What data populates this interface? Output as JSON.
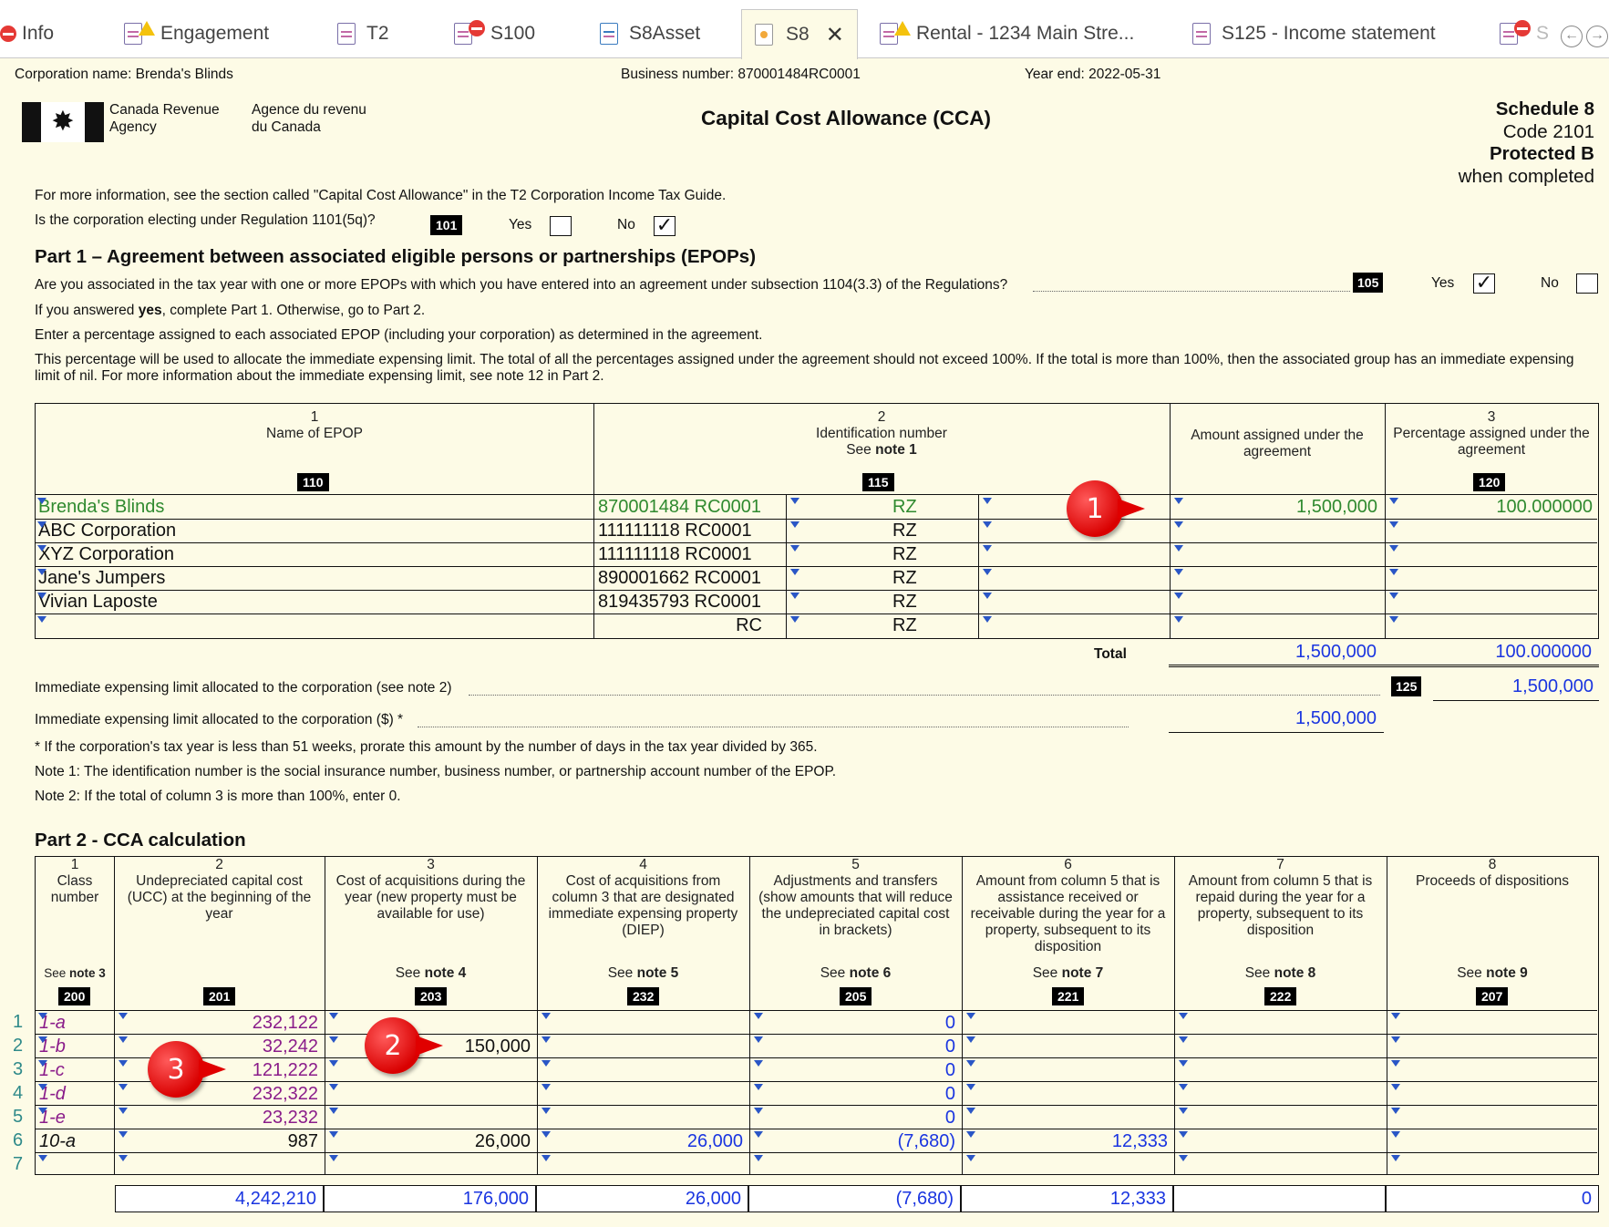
{
  "tabs": [
    {
      "label": "Info",
      "icon": "error-icon"
    },
    {
      "label": "Engagement",
      "icon": "warning-doc-icon"
    },
    {
      "label": "T2",
      "icon": "doc-icon"
    },
    {
      "label": "S100",
      "icon": "error-doc-icon"
    },
    {
      "label": "S8Asset",
      "icon": "doc-icon"
    },
    {
      "label": "S8",
      "icon": "active-doc-icon",
      "close": "✕"
    },
    {
      "label": "Rental - 1234 Main Stre...",
      "icon": "warning-doc-icon"
    },
    {
      "label": "S125 - Income statement",
      "icon": "doc-icon"
    },
    {
      "label": "S",
      "icon": "error-doc-icon"
    }
  ],
  "header": {
    "corp_name": "Corporation name: Brenda's Blinds",
    "business_number": "Business number: 870001484RC0001",
    "year_end": "Year end: 2022-05-31",
    "agency_en_1": "Canada Revenue",
    "agency_en_2": "Agency",
    "agency_fr_1": "Agence du revenu",
    "agency_fr_2": "du Canada",
    "title": "Capital Cost Allowance (CCA)",
    "schedule": "Schedule 8",
    "code": "Code 2101",
    "protected": "Protected B",
    "when_completed": "when completed"
  },
  "intro": {
    "more_info": "For more information, see the section called \"Capital Cost Allowance\" in the T2 Corporation Income Tax Guide.",
    "regulation_q": "Is the corporation electing under Regulation 1101(5q)?",
    "code": "101",
    "yes": "Yes",
    "no": "No",
    "checked_mark": "✓"
  },
  "part1": {
    "title": "Part 1 – Agreement between associated eligible persons or partnerships (EPOPs)",
    "question": "Are you associated in the tax year with one or more EPOPs with which you have entered into an agreement under subsection 1104(3.3) of the Regulations?",
    "code": "105",
    "yes": "Yes",
    "no": "No",
    "answer_pre": "If you answered ",
    "answer_bold": "yes",
    "answer_post": ", complete Part 1. Otherwise, go to Part 2.",
    "enter_pct": "Enter a percentage assigned to each associated EPOP (including your corporation) as determined in the agreement.",
    "pct_note": "This percentage will be used to allocate the immediate expensing limit. The total of all the percentages assigned under the agreement should not exceed 100%. If the total is more than 100%, then the associated group has an immediate expensing limit of nil. For more information about the immediate expensing limit, see note 12 in Part 2.",
    "col1_num": "1",
    "col1_label": "Name of EPOP",
    "col1_code": "110",
    "col2_num": "2",
    "col2_label": "Identification number",
    "col2_note_pre": "See ",
    "col2_note": "note 1",
    "col2_code": "115",
    "col_amount_label": "Amount assigned under the agreement",
    "col3_num": "3",
    "col3_label": "Percentage assigned under the agreement",
    "col3_code": "120",
    "rows": [
      {
        "name": "Brenda's Blinds",
        "id": "870001484 RC0001",
        "rz": "RZ",
        "amount": "1,500,000",
        "pct": "100.000000"
      },
      {
        "name": "ABC Corporation",
        "id": "111111118 RC0001",
        "rz": "RZ",
        "amount": "",
        "pct": ""
      },
      {
        "name": "XYZ Corporation",
        "id": "111111118 RC0001",
        "rz": "RZ",
        "amount": "",
        "pct": ""
      },
      {
        "name": "Jane's Jumpers",
        "id": "890001662 RC0001",
        "rz": "RZ",
        "amount": "",
        "pct": ""
      },
      {
        "name": "Vivian Laposte",
        "id": "819435793 RC0001",
        "rz": "RZ",
        "amount": "",
        "pct": ""
      },
      {
        "name": "",
        "id": "RC",
        "rz": "RZ",
        "amount": "",
        "pct": ""
      }
    ],
    "total_label": "Total",
    "total_amount": "1,500,000",
    "total_pct": "100.000000",
    "limit1_label": "Immediate expensing limit allocated to the corporation (see note 2)",
    "limit1_code": "125",
    "limit1_value": "1,500,000",
    "limit2_label": "Immediate expensing limit allocated to the corporation ($) *",
    "limit2_value": "1,500,000",
    "footnote": "* If the corporation's tax year is less than 51 weeks, prorate this amount by the number of days in the tax year divided by 365.",
    "note1": "Note 1: The identification number is the social insurance number, business number, or partnership account number of the EPOP.",
    "note2": "Note 2: If the total of column 3 is more than 100%, enter 0."
  },
  "part2": {
    "title": "Part 2 - CCA calculation",
    "columns": [
      {
        "num": "1",
        "label": "Class number",
        "note_pre": "See ",
        "note": "note 3",
        "code": "200"
      },
      {
        "num": "2",
        "label": "Undepreciated capital cost (UCC) at the beginning of the year",
        "note_pre": "",
        "note": "",
        "code": "201"
      },
      {
        "num": "3",
        "label": "Cost of acquisitions during the year (new property must be available for use)",
        "note_pre": "See ",
        "note": "note 4",
        "code": "203"
      },
      {
        "num": "4",
        "label": "Cost of acquisitions from column 3 that are designated immediate expensing property (DIEP)",
        "note_pre": "See ",
        "note": "note 5",
        "code": "232"
      },
      {
        "num": "5",
        "label": "Adjustments and transfers (show amounts that will reduce the undepreciated capital cost in brackets)",
        "note_pre": "See ",
        "note": "note 6",
        "code": "205"
      },
      {
        "num": "6",
        "label": "Amount from column 5 that is assistance received or receivable during the year for a property, subsequent to its disposition",
        "note_pre": "See ",
        "note": "note 7",
        "code": "221"
      },
      {
        "num": "7",
        "label": "Amount from column 5 that is repaid during the year for a property, subsequent to its disposition",
        "note_pre": "See ",
        "note": "note 8",
        "code": "222"
      },
      {
        "num": "8",
        "label": "Proceeds of dispositions",
        "note_pre": "See ",
        "note": "note 9",
        "code": "207"
      }
    ],
    "rows": [
      {
        "n": "1",
        "cls": "1-a",
        "ucc": "232,122",
        "acq": "",
        "diep": "",
        "adj": "0",
        "assist": "",
        "repaid": "",
        "proceeds": ""
      },
      {
        "n": "2",
        "cls": "1-b",
        "ucc": "32,242",
        "acq": "150,000",
        "diep": "",
        "adj": "0",
        "assist": "",
        "repaid": "",
        "proceeds": ""
      },
      {
        "n": "3",
        "cls": "1-c",
        "ucc": "121,222",
        "acq": "",
        "diep": "",
        "adj": "0",
        "assist": "",
        "repaid": "",
        "proceeds": ""
      },
      {
        "n": "4",
        "cls": "1-d",
        "ucc": "232,322",
        "acq": "",
        "diep": "",
        "adj": "0",
        "assist": "",
        "repaid": "",
        "proceeds": ""
      },
      {
        "n": "5",
        "cls": "1-e",
        "ucc": "23,232",
        "acq": "",
        "diep": "",
        "adj": "0",
        "assist": "",
        "repaid": "",
        "proceeds": ""
      },
      {
        "n": "6",
        "cls": "10-a",
        "ucc": "987",
        "acq": "26,000",
        "diep": "26,000",
        "adj": "(7,680)",
        "assist": "12,333",
        "repaid": "",
        "proceeds": ""
      },
      {
        "n": "7",
        "cls": "",
        "ucc": "",
        "acq": "",
        "diep": "",
        "adj": "",
        "assist": "",
        "repaid": "",
        "proceeds": ""
      }
    ],
    "totals": {
      "ucc": "4,242,210",
      "acq": "176,000",
      "diep": "26,000",
      "adj": "(7,680)",
      "assist": "12,333",
      "repaid": "",
      "proceeds": "0"
    }
  },
  "callouts": [
    "1",
    "2",
    "3"
  ]
}
